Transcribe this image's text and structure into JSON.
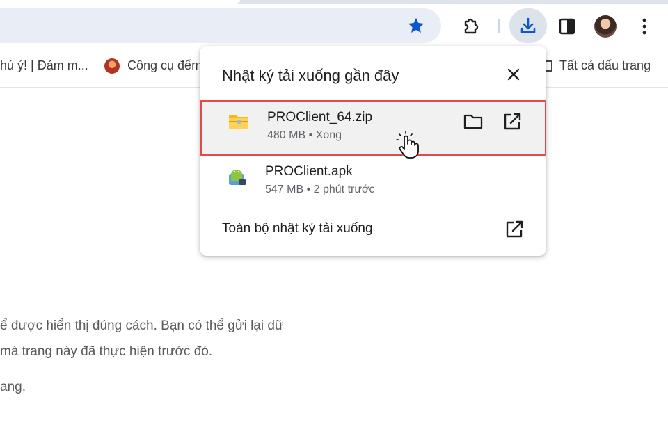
{
  "toolbar": {
    "icons": [
      "star-icon",
      "extensions-icon",
      "download-icon",
      "side-panel-icon",
      "avatar",
      "more-menu-icon"
    ],
    "accent_color": "#0b57d0"
  },
  "bookmarks": {
    "items": [
      {
        "label": "hú ý! | Đám m..."
      },
      {
        "label": "Công cụ đếm"
      },
      {
        "label": "Tất cả dấu trang"
      }
    ]
  },
  "downloads": {
    "title": "Nhật ký tải xuống gần đây",
    "items": [
      {
        "name": "PROClient_64.zip",
        "meta": "480 MB • Xong"
      },
      {
        "name": "PROClient.apk",
        "meta": "547 MB • 2 phút trước"
      }
    ],
    "footer_link": "Toàn bộ nhật ký tải xuống"
  },
  "page": {
    "lines": [
      "ể được hiển thị đúng cách. Bạn có thể gửi lại dữ",
      "mà trang này đã thực hiện trước đó.",
      "ang."
    ]
  }
}
